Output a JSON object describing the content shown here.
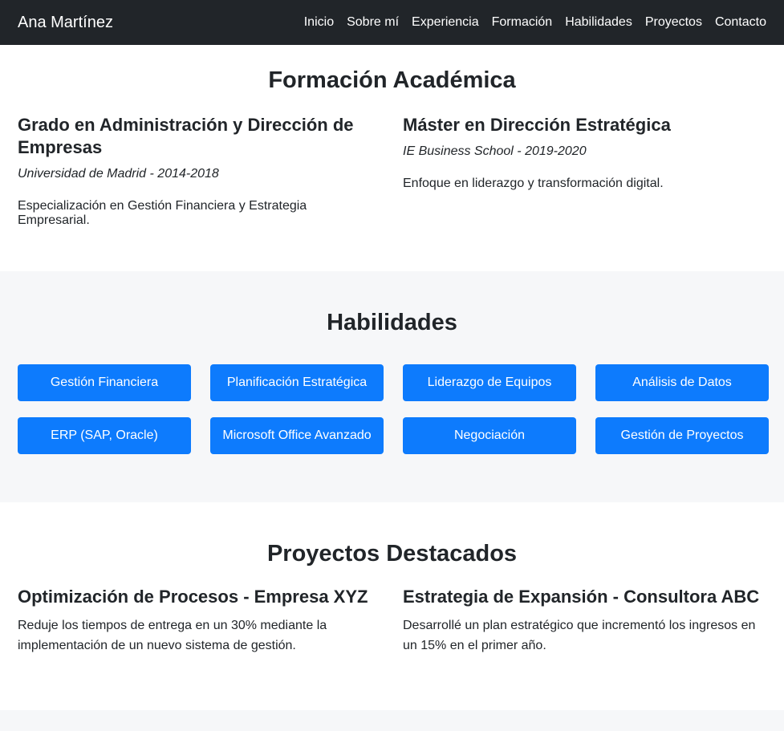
{
  "nav": {
    "brand": "Ana Martínez",
    "links": [
      "Inicio",
      "Sobre mí",
      "Experiencia",
      "Formación",
      "Habilidades",
      "Proyectos",
      "Contacto"
    ]
  },
  "education": {
    "title": "Formación Académica",
    "items": [
      {
        "degree": "Grado en Administración y Dirección de Empresas",
        "meta": "Universidad de Madrid - 2014-2018",
        "desc": "Especialización en Gestión Financiera y Estrategia Empresarial."
      },
      {
        "degree": "Máster en Dirección Estratégica",
        "meta": "IE Business School - 2019-2020",
        "desc": "Enfoque en liderazgo y transformación digital."
      }
    ]
  },
  "skills": {
    "title": "Habilidades",
    "items": [
      "Gestión Financiera",
      "Planificación Estratégica",
      "Liderazgo de Equipos",
      "Análisis de Datos",
      "ERP (SAP, Oracle)",
      "Microsoft Office Avanzado",
      "Negociación",
      "Gestión de Proyectos"
    ]
  },
  "projects": {
    "title": "Proyectos Destacados",
    "items": [
      {
        "title": "Optimización de Procesos - Empresa XYZ",
        "desc": "Reduje los tiempos de entrega en un 30% mediante la implementación de un nuevo sistema de gestión."
      },
      {
        "title": "Estrategia de Expansión - Consultora ABC",
        "desc": "Desarrollé un plan estratégico que incrementó los ingresos en un 15% en el primer año."
      }
    ]
  },
  "colors": {
    "navbar": "#212529",
    "accent": "#0d7bfd",
    "section_alt": "#f6f7f9"
  }
}
